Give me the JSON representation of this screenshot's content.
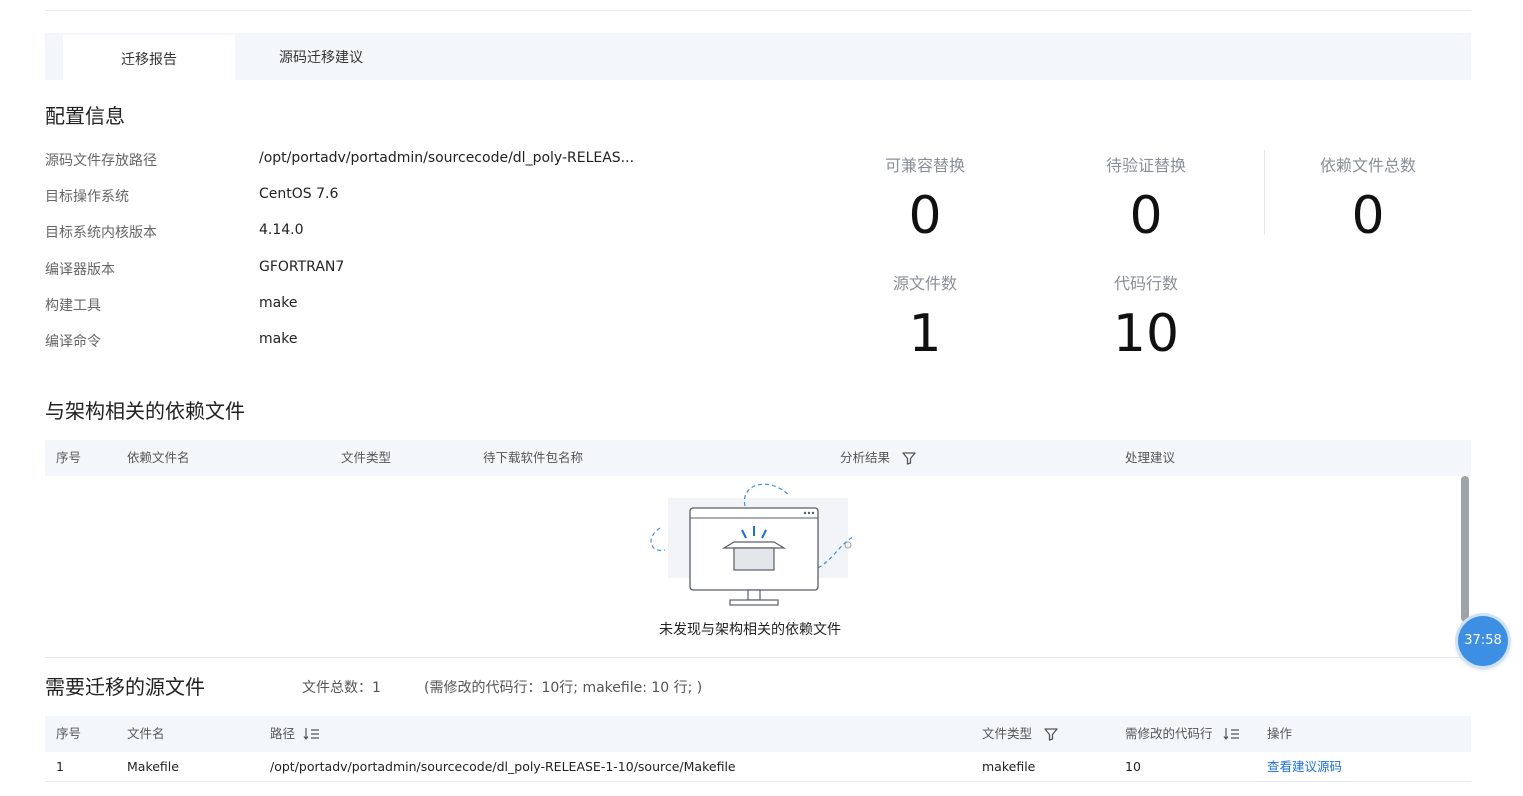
{
  "tabs": [
    {
      "label": "迁移报告",
      "active": true
    },
    {
      "label": "源码迁移建议",
      "active": false
    }
  ],
  "config": {
    "title": "配置信息",
    "rows": [
      {
        "label": "源码文件存放路径",
        "value": "/opt/portadv/portadmin/sourcecode/dl_poly-RELEAS..."
      },
      {
        "label": "目标操作系统",
        "value": "CentOS 7.6"
      },
      {
        "label": "目标系统内核版本",
        "value": "4.14.0"
      },
      {
        "label": "编译器版本",
        "value": "GFORTRAN7"
      },
      {
        "label": "构建工具",
        "value": "make"
      },
      {
        "label": "编译命令",
        "value": "make"
      }
    ]
  },
  "stats": [
    {
      "label": "可兼容替换",
      "value": "0"
    },
    {
      "label": "待验证替换",
      "value": "0"
    },
    {
      "label": "依赖文件总数",
      "value": "0"
    },
    {
      "label": "源文件数",
      "value": "1"
    },
    {
      "label": "代码行数",
      "value": "10"
    }
  ],
  "dependencies": {
    "title": "与架构相关的依赖文件",
    "columns": [
      "序号",
      "依赖文件名",
      "文件类型",
      "待下载软件包名称",
      "分析结果",
      "处理建议"
    ],
    "empty_text": "未发现与架构相关的依赖文件"
  },
  "sources": {
    "title": "需要迁移的源文件",
    "summary": "文件总数：1",
    "detail": "(需修改的代码行：10行; makefile: 10 行; )",
    "columns": [
      "序号",
      "文件名",
      "路径",
      "文件类型",
      "需修改的代码行",
      "操作"
    ],
    "rows": [
      {
        "index": "1",
        "name": "Makefile",
        "path": "/opt/portadv/portadmin/sourcecode/dl_poly-RELEASE-1-10/source/Makefile",
        "type": "makefile",
        "lines": "10",
        "action": "查看建议源码"
      }
    ]
  },
  "timer": "37:58",
  "colors": {
    "accent": "#1e6fd9",
    "header_bg": "#f3f7fc",
    "timer_bg": "#3d8fe3"
  }
}
